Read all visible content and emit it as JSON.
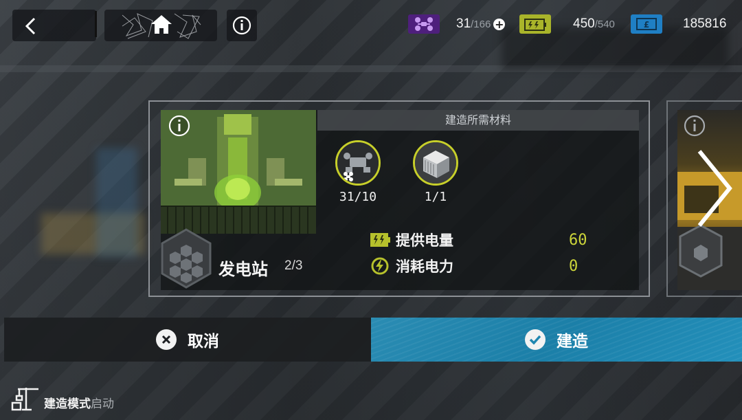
{
  "colors": {
    "accent_yellow": "#cdd63a",
    "build_blue": "#1f86b0",
    "drone_purple": "#6b2fa3",
    "energy_blue": "#2a8fd0"
  },
  "topbar": {
    "back_icon": "chevron-left-icon",
    "home_icon": "home-icon",
    "info_icon": "info-icon",
    "drones": {
      "icon": "drone-icon",
      "current": "31",
      "max": "/166"
    },
    "energy": {
      "icon": "battery-icon",
      "current": "450",
      "max": "/540"
    },
    "credits": {
      "icon": "credit-card-icon",
      "value": "185816"
    }
  },
  "card": {
    "info_icon": "info-icon",
    "materials_header": "建造所需材料",
    "materials": [
      {
        "icon": "drone-part-icon",
        "count": "31/10"
      },
      {
        "icon": "steel-block-icon",
        "count": "1/1"
      }
    ],
    "building_name": "发电站",
    "building_count": "2/3",
    "stats": [
      {
        "icon": "battery-icon",
        "label": "提供电量",
        "value": "60"
      },
      {
        "icon": "power-consume-icon",
        "label": "消耗电力",
        "value": "0"
      }
    ]
  },
  "buttons": {
    "cancel_label": "取消",
    "build_label": "建造"
  },
  "mode": {
    "prefix": "建造模式",
    "suffix": "启动"
  }
}
